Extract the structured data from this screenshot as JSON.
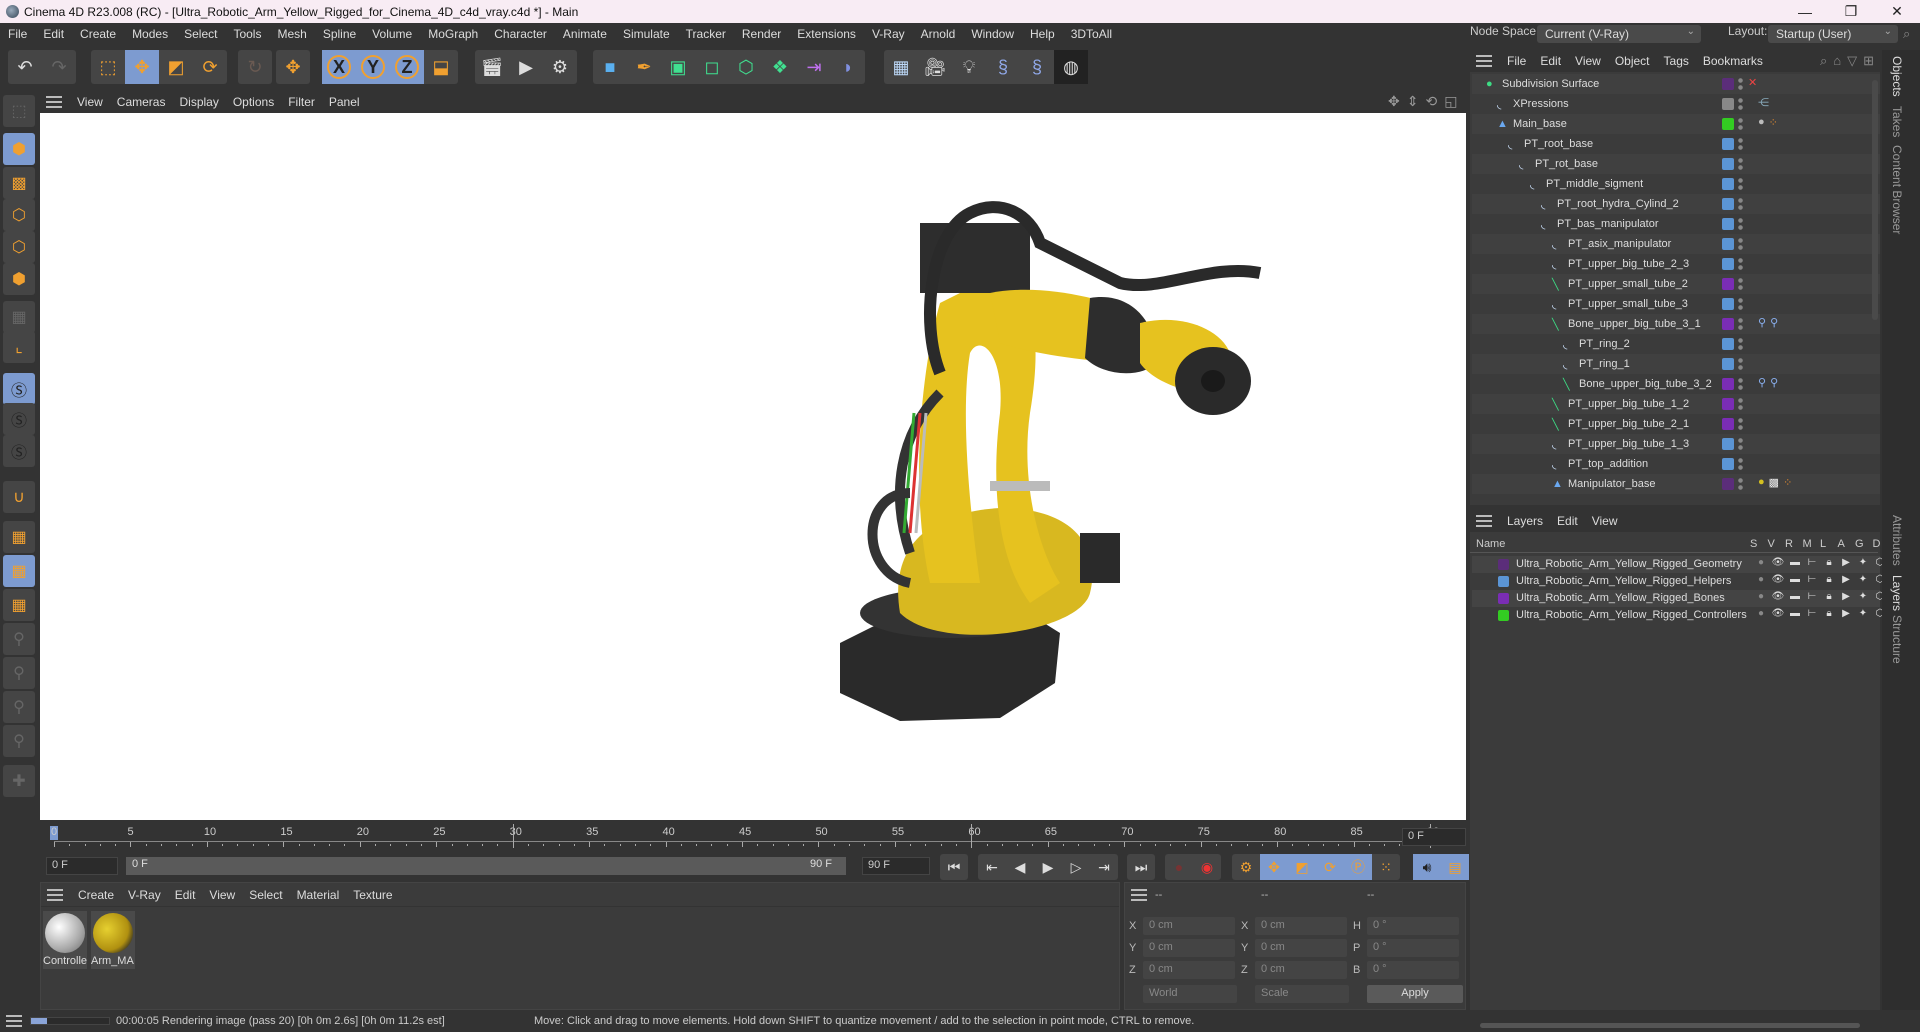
{
  "window": {
    "title": "Cinema 4D R23.008 (RC) - [Ultra_Robotic_Arm_Yellow_Rigged_for_Cinema_4D_c4d_vray.c4d *] - Main",
    "controls": {
      "minimize": "—",
      "maximize": "❐",
      "close": "✕"
    }
  },
  "menubar": [
    "File",
    "Edit",
    "Create",
    "Modes",
    "Select",
    "Tools",
    "Mesh",
    "Spline",
    "Volume",
    "MoGraph",
    "Character",
    "Animate",
    "Simulate",
    "Tracker",
    "Render",
    "Extensions",
    "V-Ray",
    "Arnold",
    "Window",
    "Help",
    "3DToAll"
  ],
  "node_space": {
    "label": "Node Space:",
    "value": "Current (V-Ray)"
  },
  "layout": {
    "label": "Layout:",
    "value": "Startup (User)"
  },
  "toolbar": {
    "history": [
      "undo-icon",
      "redo-icon"
    ],
    "modes": [
      "live-selection-icon",
      "move-icon",
      "scale-icon",
      "rotate-icon",
      "psr-icon",
      "coord-move-icon"
    ],
    "axes": [
      "X",
      "Y",
      "Z",
      "world-coordinates-icon"
    ],
    "render": [
      "render-view-icon",
      "render-picture-viewer-icon",
      "render-settings-icon"
    ],
    "objects": [
      "cube-icon",
      "pen-icon",
      "subdivision-icon",
      "extrude-icon",
      "deformer-icon",
      "cloner-icon",
      "symmetry-icon",
      "bend-icon",
      "floor-icon",
      "camera-icon",
      "light-icon",
      "python-icon",
      "python2-icon",
      "sky-icon"
    ]
  },
  "viewport": {
    "menu": [
      "View",
      "Cameras",
      "Display",
      "Options",
      "Filter",
      "Panel"
    ],
    "nav_icons": [
      "pan-icon",
      "dolly-icon",
      "orbit-icon",
      "maximize-view-icon"
    ]
  },
  "left_tools": [
    "make-editable",
    "model-mode",
    "texture-mode",
    "point-mode",
    "edge-mode",
    "polygon-mode",
    "uv-mode",
    "axis-mode",
    "solo-off",
    "solo-single",
    "solo-hierarchy",
    "snap",
    "workplane",
    "locked-workplane",
    "workplane-align",
    "pin-tool",
    "pin-p",
    "pin-r",
    "pin-target",
    "add-joint"
  ],
  "timeline": {
    "ticks": [
      "0",
      "5",
      "10",
      "15",
      "20",
      "25",
      "30",
      "35",
      "40",
      "45",
      "50",
      "55",
      "60",
      "65",
      "70",
      "75",
      "80",
      "85",
      "90"
    ],
    "current_frame": "0 F",
    "range_start": "0 F",
    "range_start_label": "0 F",
    "range_end_label": "90 F",
    "range_end": "90 F",
    "frame_right": "0 F",
    "current_position": 0,
    "total_frames": 90
  },
  "playback": {
    "buttons": [
      "go-start",
      "go-prev-key",
      "prev-frame",
      "play",
      "next-frame",
      "go-next-key",
      "go-end"
    ]
  },
  "materials": {
    "menu": [
      "Create",
      "V-Ray",
      "Edit",
      "View",
      "Select",
      "Material",
      "Texture"
    ],
    "items": [
      {
        "name": "Controlle",
        "color": "#d8d8d8"
      },
      {
        "name": "Arm_MA",
        "color": "#d4c020"
      }
    ]
  },
  "coordinates": {
    "headers": [
      "--",
      "--",
      "--"
    ],
    "pos": [
      {
        "axis": "X",
        "value": "0 cm"
      },
      {
        "axis": "Y",
        "value": "0 cm"
      },
      {
        "axis": "Z",
        "value": "0 cm"
      }
    ],
    "size": [
      {
        "axis": "X",
        "value": "0 cm"
      },
      {
        "axis": "Y",
        "value": "0 cm"
      },
      {
        "axis": "Z",
        "value": "0 cm"
      }
    ],
    "rot": [
      {
        "axis": "H",
        "value": "0 °"
      },
      {
        "axis": "P",
        "value": "0 °"
      },
      {
        "axis": "B",
        "value": "0 °"
      }
    ],
    "mode": "World",
    "scale_mode": "Scale",
    "apply": "Apply"
  },
  "status": {
    "render_text": "00:00:05 Rendering image (pass 20) [0h  0m  2.6s] [0h  0m 11.2s est]",
    "render_progress": 0.2,
    "hint": "Move: Click and drag to move elements. Hold down SHIFT to quantize movement / add to the selection in point mode, CTRL to remove."
  },
  "object_manager": {
    "menu": [
      "File",
      "Edit",
      "View",
      "Object",
      "Tags",
      "Bookmarks"
    ],
    "objects": [
      {
        "name": "Subdivision Surface",
        "depth": 0,
        "icon": "subdivision",
        "color": "#5b2d7a",
        "tags": "x"
      },
      {
        "name": "XPressions",
        "depth": 1,
        "icon": "null",
        "color": "#888888",
        "tags": "xpresso"
      },
      {
        "name": "Main_base",
        "depth": 1,
        "icon": "joint",
        "color": "#33cc22",
        "tags": "mat"
      },
      {
        "name": "PT_root_base",
        "depth": 2,
        "icon": "null",
        "color": "#5b95d5",
        "tags": ""
      },
      {
        "name": "PT_rot_base",
        "depth": 3,
        "icon": "null",
        "color": "#5b95d5",
        "tags": ""
      },
      {
        "name": "PT_middle_sigment",
        "depth": 4,
        "icon": "null",
        "color": "#5b95d5",
        "tags": ""
      },
      {
        "name": "PT_root_hydra_Cylind_2",
        "depth": 5,
        "icon": "null",
        "color": "#5b95d5",
        "tags": ""
      },
      {
        "name": "PT_bas_manipulator",
        "depth": 5,
        "icon": "null",
        "color": "#5b95d5",
        "tags": ""
      },
      {
        "name": "PT_asix_manipulator",
        "depth": 6,
        "icon": "null",
        "color": "#5b95d5",
        "tags": ""
      },
      {
        "name": "PT_upper_big_tube_2_3",
        "depth": 6,
        "icon": "null",
        "color": "#5b95d5",
        "tags": ""
      },
      {
        "name": "PT_upper_small_tube_2",
        "depth": 6,
        "icon": "bone",
        "color": "#7a2db5",
        "tags": ""
      },
      {
        "name": "PT_upper_small_tube_3",
        "depth": 6,
        "icon": "null",
        "color": "#5b95d5",
        "tags": ""
      },
      {
        "name": "Bone_upper_big_tube_3_1",
        "depth": 6,
        "icon": "bone",
        "color": "#7a2db5",
        "tags": "pin"
      },
      {
        "name": "PT_ring_2",
        "depth": 7,
        "icon": "null",
        "color": "#5b95d5",
        "tags": ""
      },
      {
        "name": "PT_ring_1",
        "depth": 7,
        "icon": "null",
        "color": "#5b95d5",
        "tags": ""
      },
      {
        "name": "Bone_upper_big_tube_3_2",
        "depth": 7,
        "icon": "bone",
        "color": "#7a2db5",
        "tags": "pin"
      },
      {
        "name": "PT_upper_big_tube_1_2",
        "depth": 6,
        "icon": "bone",
        "color": "#7a2db5",
        "tags": ""
      },
      {
        "name": "PT_upper_big_tube_2_1",
        "depth": 6,
        "icon": "bone",
        "color": "#7a2db5",
        "tags": ""
      },
      {
        "name": "PT_upper_big_tube_1_3",
        "depth": 6,
        "icon": "null",
        "color": "#5b95d5",
        "tags": ""
      },
      {
        "name": "PT_top_addition",
        "depth": 6,
        "icon": "null",
        "color": "#5b95d5",
        "tags": ""
      },
      {
        "name": "Manipulator_base",
        "depth": 6,
        "icon": "joint",
        "color": "#5b2d7a",
        "tags": "mat2"
      }
    ]
  },
  "layer_manager": {
    "menu": [
      "Layers",
      "Edit",
      "View"
    ],
    "columns": [
      "Name",
      "S",
      "V",
      "R",
      "M",
      "L",
      "A",
      "G",
      "D"
    ],
    "layers": [
      {
        "name": "Ultra_Robotic_Arm_Yellow_Rigged_Geometry",
        "color": "#5b2d7a"
      },
      {
        "name": "Ultra_Robotic_Arm_Yellow_Rigged_Helpers",
        "color": "#5b95d5"
      },
      {
        "name": "Ultra_Robotic_Arm_Yellow_Rigged_Bones",
        "color": "#7a2db5"
      },
      {
        "name": "Ultra_Robotic_Arm_Yellow_Rigged_Controllers",
        "color": "#33cc22"
      }
    ]
  },
  "side_tabs": {
    "top": [
      "Objects",
      "Takes",
      "Content Browser"
    ],
    "bottom": [
      "Attributes",
      "Layers",
      "Structure"
    ]
  }
}
